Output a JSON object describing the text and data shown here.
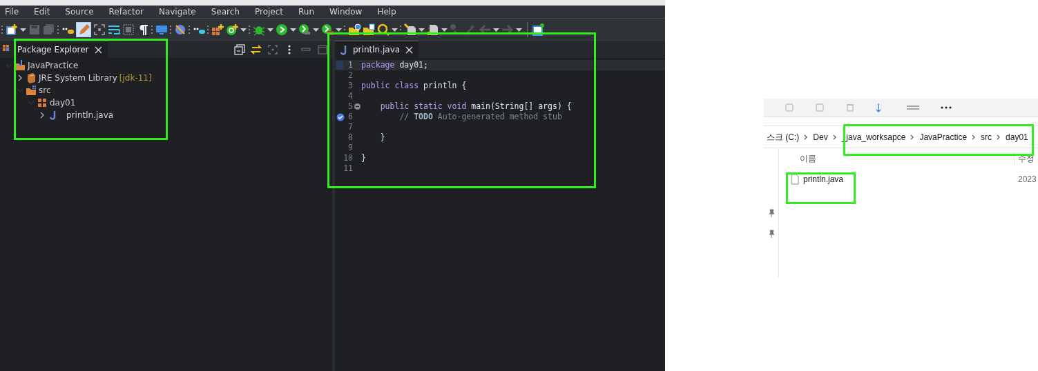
{
  "menu": [
    "File",
    "Edit",
    "Source",
    "Refactor",
    "Navigate",
    "Search",
    "Project",
    "Run",
    "Window",
    "Help"
  ],
  "package_explorer": {
    "title": "Package Explorer",
    "tree": [
      {
        "label": "JavaPractice",
        "kind": "project",
        "expanded": true,
        "children": [
          {
            "label": "JRE System Library",
            "decoration": "[jdk-11]",
            "kind": "library",
            "expanded": false
          },
          {
            "label": "src",
            "kind": "source-folder",
            "expanded": true,
            "children": [
              {
                "label": "day01",
                "kind": "package",
                "expanded": true,
                "children": [
                  {
                    "label": "println.java",
                    "kind": "java-file",
                    "expanded": false
                  }
                ]
              }
            ]
          }
        ]
      }
    ]
  },
  "editor": {
    "tab": "println.java",
    "lines": [
      {
        "number": "1",
        "current": true,
        "fold": false,
        "task": false,
        "tokens": [
          {
            "text": "package",
            "kind": "keyword"
          },
          {
            "text": " day01;",
            "kind": "plain"
          }
        ]
      },
      {
        "number": "2",
        "current": false,
        "fold": false,
        "task": false
      },
      {
        "number": "3",
        "current": false,
        "fold": false,
        "task": false,
        "tokens": [
          {
            "text": "public class",
            "kind": "keyword"
          },
          {
            "text": " println {",
            "kind": "plain"
          }
        ]
      },
      {
        "number": "4",
        "current": false,
        "fold": false,
        "task": false
      },
      {
        "number": "5",
        "current": false,
        "fold": true,
        "task": false,
        "tokens": [
          {
            "text": "    public static void",
            "kind": "keyword"
          },
          {
            "text": " main(String[] args) {",
            "kind": "plain"
          }
        ]
      },
      {
        "number": "6",
        "current": false,
        "fold": false,
        "task": true,
        "tokens": [
          {
            "text": "        //",
            "kind": "comment"
          },
          {
            "text": " TODO",
            "kind": "todo"
          },
          {
            "text": " Auto-generated method stub",
            "kind": "comment"
          }
        ]
      },
      {
        "number": "7",
        "current": false,
        "fold": false,
        "task": false
      },
      {
        "number": "8",
        "current": false,
        "fold": false,
        "task": false,
        "tokens": [
          {
            "text": "    }",
            "kind": "plain"
          }
        ]
      },
      {
        "number": "9",
        "current": false,
        "fold": false,
        "task": false
      },
      {
        "number": "10",
        "current": false,
        "fold": false,
        "task": false,
        "tokens": [
          {
            "text": "}",
            "kind": "plain"
          }
        ]
      },
      {
        "number": "11",
        "current": false,
        "fold": false,
        "task": false
      }
    ]
  },
  "file_explorer": {
    "breadcrumb": [
      "스크 (C:)",
      "Dev",
      "_java_worksapce",
      "JavaPractice",
      "src",
      "day01"
    ],
    "columns": [
      "이름",
      "수정"
    ],
    "files": [
      {
        "name": "println.java",
        "modified": "2023"
      }
    ]
  }
}
